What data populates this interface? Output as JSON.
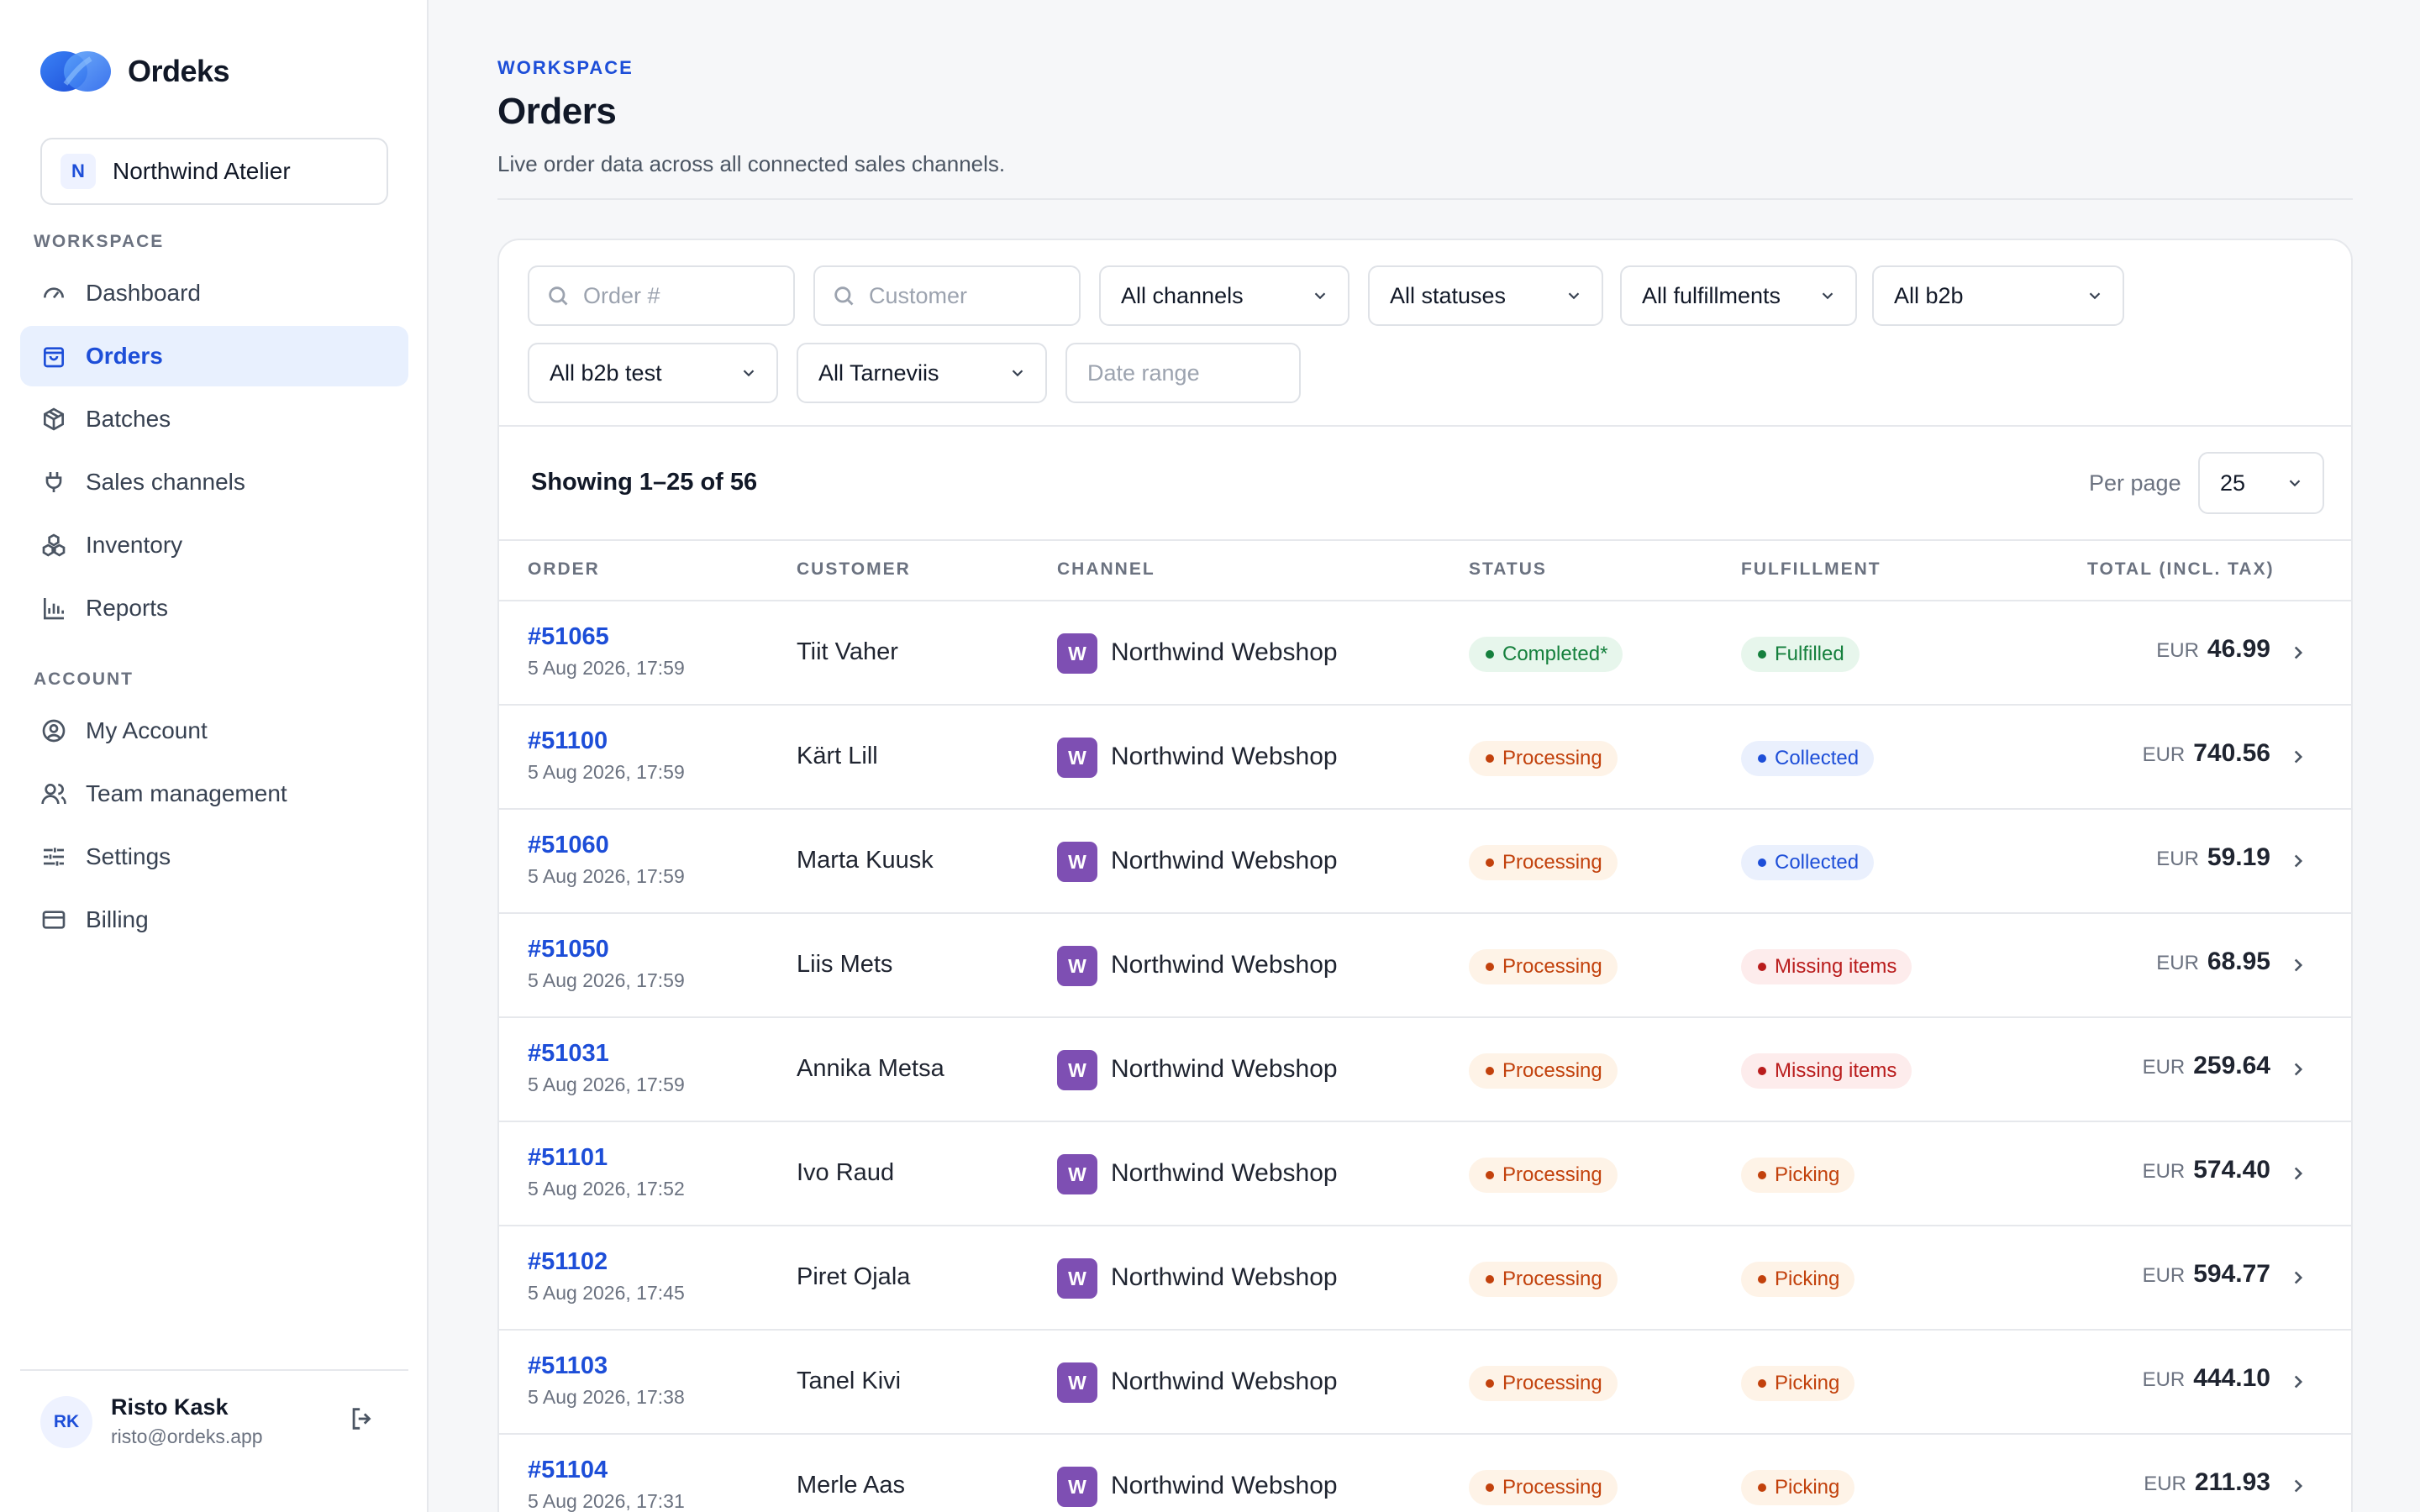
{
  "app": {
    "name": "Ordeks"
  },
  "workspace_switcher": {
    "initial": "N",
    "name": "Northwind Atelier"
  },
  "sidebar": {
    "section_workspace": "WORKSPACE",
    "section_account": "ACCOUNT",
    "workspace_items": [
      {
        "label": "Dashboard",
        "icon": "gauge-icon"
      },
      {
        "label": "Orders",
        "icon": "shopping-bag-icon",
        "active": true
      },
      {
        "label": "Batches",
        "icon": "package-icon"
      },
      {
        "label": "Sales channels",
        "icon": "plug-icon"
      },
      {
        "label": "Inventory",
        "icon": "boxes-icon"
      },
      {
        "label": "Reports",
        "icon": "bar-chart-icon"
      }
    ],
    "account_items": [
      {
        "label": "My Account",
        "icon": "user-circle-icon"
      },
      {
        "label": "Team management",
        "icon": "users-icon"
      },
      {
        "label": "Settings",
        "icon": "sliders-icon"
      },
      {
        "label": "Billing",
        "icon": "credit-card-icon"
      }
    ]
  },
  "user": {
    "initials": "RK",
    "name": "Risto Kask",
    "email": "risto@ordeks.app"
  },
  "header": {
    "eyebrow": "WORKSPACE",
    "title": "Orders",
    "subtitle": "Live order data across all connected sales channels."
  },
  "filters": {
    "order_placeholder": "Order #",
    "customer_placeholder": "Customer",
    "channels": "All channels",
    "statuses": "All statuses",
    "fulfillments": "All fulfillments",
    "b2b": "All b2b",
    "b2b_test": "All b2b test",
    "tarneviis": "All Tarneviis",
    "date_placeholder": "Date range"
  },
  "list": {
    "showing": "Showing 1–25 of 56",
    "per_page_label": "Per page",
    "per_page_value": "25"
  },
  "table": {
    "columns": [
      "ORDER",
      "CUSTOMER",
      "CHANNEL",
      "STATUS",
      "FULFILLMENT",
      "TOTAL (INCL. TAX)"
    ],
    "rows": [
      {
        "order": "#51065",
        "date": "5 Aug 2026, 17:59",
        "customer": "Tiit Vaher",
        "channel_initial": "W",
        "channel": "Northwind Webshop",
        "status": "Completed*",
        "status_color": "green",
        "fulfillment": "Fulfilled",
        "fulfillment_color": "green",
        "currency": "EUR",
        "total": "46.99"
      },
      {
        "order": "#51100",
        "date": "5 Aug 2026, 17:59",
        "customer": "Kärt Lill",
        "channel_initial": "W",
        "channel": "Northwind Webshop",
        "status": "Processing",
        "status_color": "orange",
        "fulfillment": "Collected",
        "fulfillment_color": "blue",
        "currency": "EUR",
        "total": "740.56"
      },
      {
        "order": "#51060",
        "date": "5 Aug 2026, 17:59",
        "customer": "Marta Kuusk",
        "channel_initial": "W",
        "channel": "Northwind Webshop",
        "status": "Processing",
        "status_color": "orange",
        "fulfillment": "Collected",
        "fulfillment_color": "blue",
        "currency": "EUR",
        "total": "59.19"
      },
      {
        "order": "#51050",
        "date": "5 Aug 2026, 17:59",
        "customer": "Liis Mets",
        "channel_initial": "W",
        "channel": "Northwind Webshop",
        "status": "Processing",
        "status_color": "orange",
        "fulfillment": "Missing items",
        "fulfillment_color": "red",
        "currency": "EUR",
        "total": "68.95"
      },
      {
        "order": "#51031",
        "date": "5 Aug 2026, 17:59",
        "customer": "Annika Metsa",
        "channel_initial": "W",
        "channel": "Northwind Webshop",
        "status": "Processing",
        "status_color": "orange",
        "fulfillment": "Missing items",
        "fulfillment_color": "red",
        "currency": "EUR",
        "total": "259.64"
      },
      {
        "order": "#51101",
        "date": "5 Aug 2026, 17:52",
        "customer": "Ivo Raud",
        "channel_initial": "W",
        "channel": "Northwind Webshop",
        "status": "Processing",
        "status_color": "orange",
        "fulfillment": "Picking",
        "fulfillment_color": "orange",
        "currency": "EUR",
        "total": "574.40"
      },
      {
        "order": "#51102",
        "date": "5 Aug 2026, 17:45",
        "customer": "Piret Ojala",
        "channel_initial": "W",
        "channel": "Northwind Webshop",
        "status": "Processing",
        "status_color": "orange",
        "fulfillment": "Picking",
        "fulfillment_color": "orange",
        "currency": "EUR",
        "total": "594.77"
      },
      {
        "order": "#51103",
        "date": "5 Aug 2026, 17:38",
        "customer": "Tanel Kivi",
        "channel_initial": "W",
        "channel": "Northwind Webshop",
        "status": "Processing",
        "status_color": "orange",
        "fulfillment": "Picking",
        "fulfillment_color": "orange",
        "currency": "EUR",
        "total": "444.10"
      },
      {
        "order": "#51104",
        "date": "5 Aug 2026, 17:31",
        "customer": "Merle Aas",
        "channel_initial": "W",
        "channel": "Northwind Webshop",
        "status": "Processing",
        "status_color": "orange",
        "fulfillment": "Picking",
        "fulfillment_color": "orange",
        "currency": "EUR",
        "total": "211.93"
      }
    ]
  }
}
